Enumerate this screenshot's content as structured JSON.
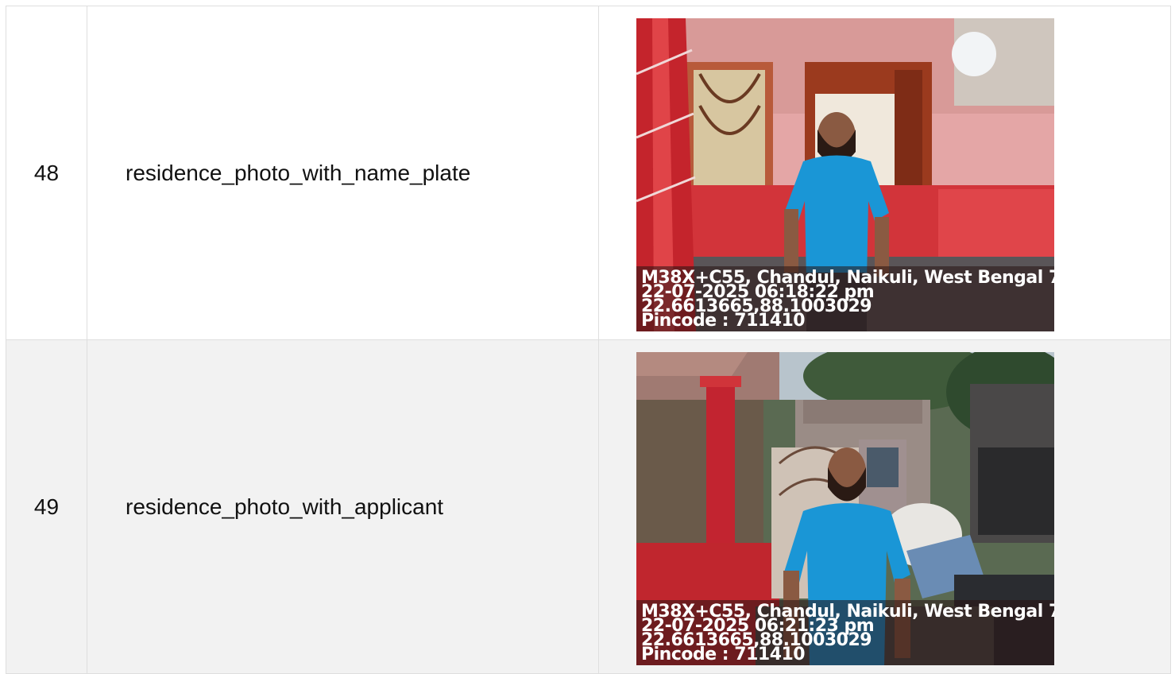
{
  "rows": [
    {
      "number": "48",
      "name": "residence_photo_with_name_plate",
      "photo": {
        "line1": "M38X+C55, Chandul, Naikuli, West Bengal 7",
        "line2": "22-07-2025 06:18:22 pm",
        "line3": "22.6613665,88.1003029",
        "line4": "Pincode : 711410"
      }
    },
    {
      "number": "49",
      "name": "residence_photo_with_applicant",
      "photo": {
        "line1": "M38X+C55, Chandul, Naikuli, West Bengal 7",
        "line2": "22-07-2025 06:21:23 pm",
        "line3": "22.6613665,88.1003029",
        "line4": "Pincode : 711410"
      }
    }
  ]
}
